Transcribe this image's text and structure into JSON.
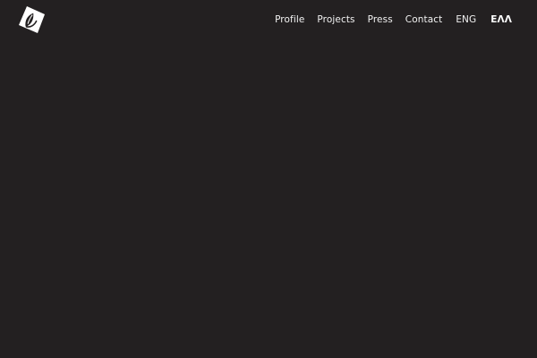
{
  "header": {
    "logo_icon": "leaf-in-diamond-logo-icon",
    "nav": {
      "items": [
        {
          "label": "Profile"
        },
        {
          "label": "Projects"
        },
        {
          "label": "Press"
        },
        {
          "label": "Contact"
        }
      ],
      "languages": [
        {
          "label": "ENG",
          "active": false
        },
        {
          "label": "ΕΛΛ",
          "active": true
        }
      ]
    }
  },
  "colors": {
    "background": "#232021",
    "text": "#f2f2f2",
    "logo": "#ffffff"
  }
}
